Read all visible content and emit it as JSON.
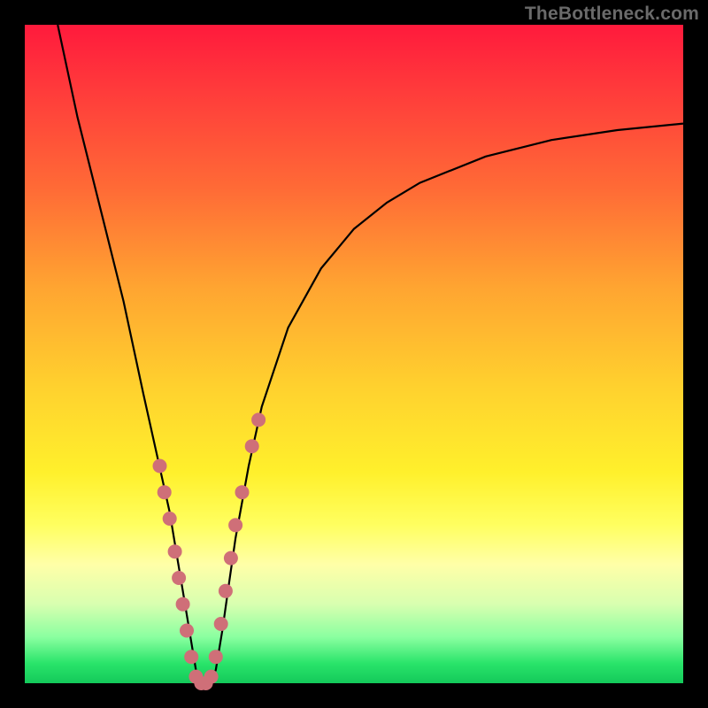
{
  "watermark": "TheBottleneck.com",
  "colors": {
    "frame_border": "#000000",
    "curve_stroke": "#000000",
    "dot_fill": "#cf6f78",
    "gradient_top": "#ff1a3c",
    "gradient_mid": "#ffd12e",
    "gradient_bottom": "#14c95a"
  },
  "chart_data": {
    "type": "line",
    "title": "",
    "xlabel": "",
    "ylabel": "",
    "xlim": [
      0,
      100
    ],
    "ylim": [
      0,
      100
    ],
    "curve": {
      "name": "bottleneck-curve",
      "x": [
        5,
        8,
        12,
        15,
        18,
        20,
        22,
        23,
        24,
        25,
        26,
        27,
        28,
        29,
        30,
        31,
        32,
        34,
        36,
        40,
        45,
        50,
        55,
        60,
        70,
        80,
        90,
        100
      ],
      "y": [
        100,
        86,
        70,
        58,
        44,
        35,
        26,
        20,
        14,
        8,
        2,
        0,
        0,
        2,
        8,
        15,
        22,
        33,
        42,
        54,
        63,
        69,
        73,
        76,
        80,
        82.5,
        84,
        85
      ]
    },
    "dots": {
      "name": "highlight-dots",
      "x": [
        20.5,
        21.2,
        22.0,
        22.8,
        23.4,
        24.0,
        24.6,
        25.3,
        26.0,
        26.8,
        27.5,
        28.3,
        29.0,
        29.8,
        30.5,
        31.3,
        32.0,
        33.0,
        34.5,
        35.5
      ],
      "y": [
        33,
        29,
        25,
        20,
        16,
        12,
        8,
        4,
        1,
        0,
        0,
        1,
        4,
        9,
        14,
        19,
        24,
        29,
        36,
        40
      ]
    }
  }
}
